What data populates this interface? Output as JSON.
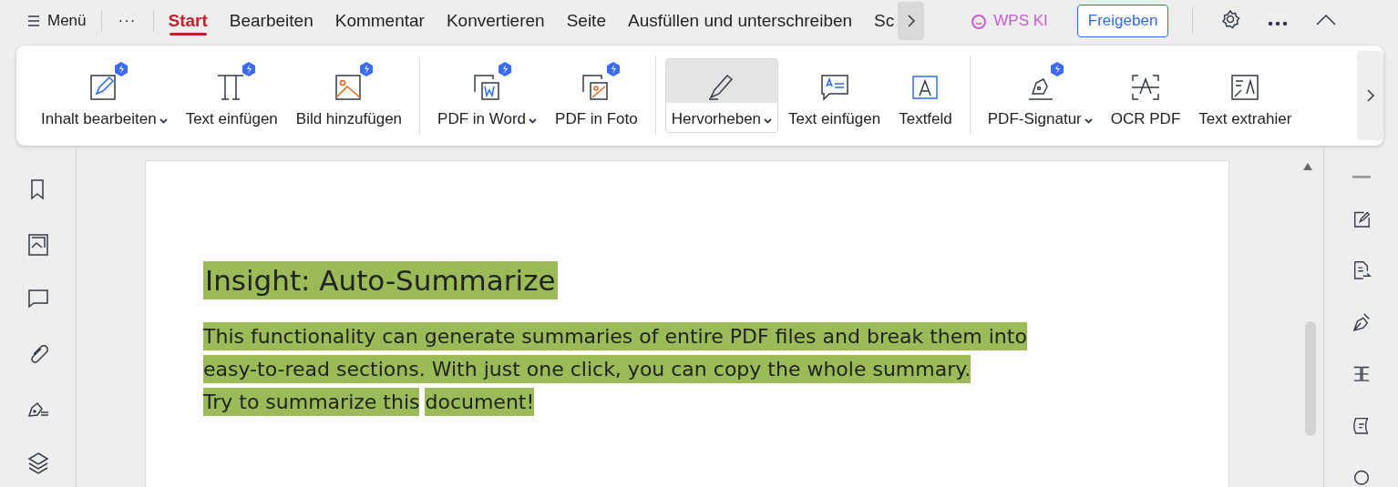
{
  "menu_bar": {
    "menu": {
      "label": "Menü"
    },
    "more": {
      "label": "···"
    },
    "tabs": [
      {
        "label": "Start",
        "selected": true
      },
      {
        "label": "Bearbeiten",
        "selected": false
      },
      {
        "label": "Kommentar",
        "selected": false
      },
      {
        "label": "Konvertieren",
        "selected": false
      },
      {
        "label": "Seite",
        "selected": false
      },
      {
        "label": "Ausfüllen und unterschreiben",
        "selected": false
      },
      {
        "label": "Sc",
        "selected": false
      }
    ],
    "ai": {
      "label": "WPS KI"
    },
    "share": {
      "label": "Freigeben"
    }
  },
  "ribbon": {
    "groups": [
      [
        {
          "label": "Inhalt bearbeiten",
          "dropdown": true,
          "ai": true,
          "selected": false
        },
        {
          "label": "Text einfügen",
          "dropdown": false,
          "ai": true,
          "selected": false
        },
        {
          "label": "Bild hinzufügen",
          "dropdown": false,
          "ai": true,
          "selected": false
        }
      ],
      [
        {
          "label": "PDF in Word",
          "dropdown": true,
          "ai": true,
          "selected": false
        },
        {
          "label": "PDF in Foto",
          "dropdown": false,
          "ai": true,
          "selected": false
        }
      ],
      [
        {
          "label": "Hervorheben",
          "dropdown": true,
          "ai": false,
          "selected": true
        },
        {
          "label": "Text einfügen",
          "dropdown": false,
          "ai": false,
          "selected": false
        },
        {
          "label": "Textfeld",
          "dropdown": false,
          "ai": false,
          "selected": false
        }
      ],
      [
        {
          "label": "PDF-Signatur",
          "dropdown": true,
          "ai": true,
          "selected": false
        },
        {
          "label": "OCR PDF",
          "dropdown": false,
          "ai": false,
          "selected": false
        },
        {
          "label": "Text extrahier",
          "dropdown": false,
          "ai": false,
          "selected": false
        }
      ]
    ]
  },
  "document": {
    "heading": "Insight: Auto-Summarize",
    "lines": [
      [
        "This functionality can generate summaries of entire PDF files and break them into"
      ],
      [
        "easy-to-read sections. With just one click, you can copy the whole summary."
      ],
      [
        "Try to summarize this",
        "document!"
      ]
    ]
  }
}
